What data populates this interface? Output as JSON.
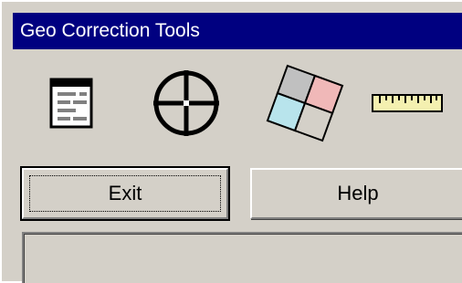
{
  "window": {
    "title": "Geo Correction Tools"
  },
  "toolbar": {
    "tools": [
      {
        "icon": "form-icon",
        "tooltip": ""
      },
      {
        "icon": "crosshair-icon",
        "tooltip": ""
      },
      {
        "icon": "grid-tiles-icon",
        "tooltip": ""
      },
      {
        "icon": "ruler-icon",
        "tooltip": ""
      }
    ]
  },
  "buttons": {
    "exit_label": "Exit",
    "help_label": "Help"
  },
  "status": {
    "text": ""
  },
  "colors": {
    "titlebar": "#000080",
    "face": "#d4d0c8",
    "tile_pink": "#f0b8b8",
    "tile_cyan": "#b8e4ec",
    "tile_gray": "#c0c0c0",
    "ruler": "#f4f0b0"
  }
}
